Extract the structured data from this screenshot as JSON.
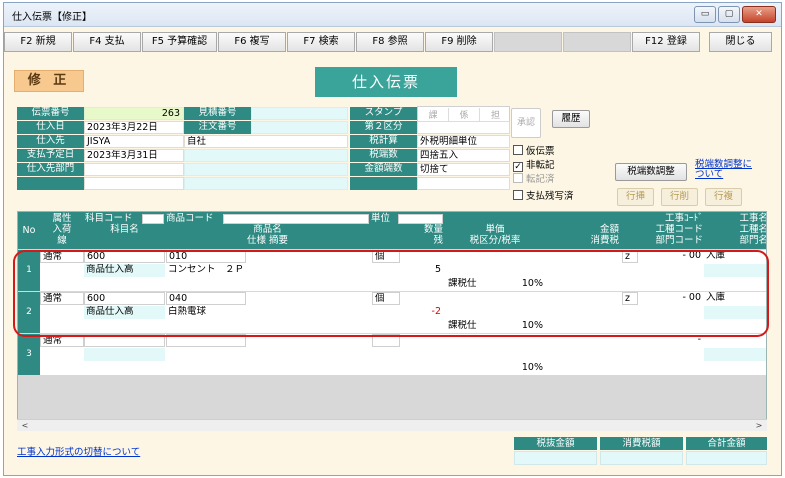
{
  "window": {
    "title": "仕入伝票【修正】",
    "min": "▭",
    "max": "▢",
    "close": "✕"
  },
  "fkeys": [
    "F2 新規",
    "F4 支払",
    "F5 予算確認",
    "F6 複写",
    "F7 検索",
    "F8 参照",
    "F9 削除",
    "",
    "",
    "F12 登録",
    "閉じる"
  ],
  "mode_label": "修 正",
  "form_title": "仕入伝票",
  "header": {
    "denpyo_label": "伝票番号",
    "denpyo_value": "263",
    "mitsumori_label": "見積番号",
    "mitsumori_value": "",
    "shiirebi_label": "仕入日",
    "shiirebi_value": "2023年3月22日",
    "chumon_label": "注文番号",
    "chumon_value": "",
    "shiiresaki_label": "仕入先",
    "shiiresaki_code": "JISYA",
    "shiiresaki_name": "自社",
    "shiharai_label": "支払予定日",
    "shiharai_value": "2023年3月31日",
    "bumon_label": "仕入先部門",
    "bumon_value": ""
  },
  "right_fields": {
    "stamp_label": "スタンプ",
    "stamps": [
      "課",
      "係",
      "担"
    ],
    "kubun2_label": "第２区分",
    "kubun2_value": "",
    "zeikeisan_label": "税計算",
    "zeikeisan_value": "外税明細単位",
    "zeihasu_label": "税端数",
    "zeihasu_value": "四捨五入",
    "kingaku_label": "金額端数",
    "kingaku_value": "切捨て"
  },
  "shonin": "承認",
  "rireki_button": "履歴",
  "checks": [
    {
      "label": "仮伝票",
      "checked": false,
      "dim": false
    },
    {
      "label": "非転記",
      "checked": true,
      "dim": false
    },
    {
      "label": "転記済",
      "checked": false,
      "dim": true
    },
    {
      "label": "支払残写済",
      "checked": false,
      "dim": false
    }
  ],
  "zeihasu_button": "税端数調整",
  "zeihasu_link": "税端数調整について",
  "row_buttons": [
    "行挿",
    "行削",
    "行複"
  ],
  "grid_header": {
    "no": "No",
    "zokusei": "属性",
    "nyuka": "入荷",
    "sen": "線",
    "kamoku_code": "科目コード",
    "kamoku_name": "科目名",
    "shohin_code": "商品コード",
    "shohin_name": "商品名",
    "shiyo": "仕様 摘要",
    "tani": "単位",
    "suryo": "数量",
    "zan": "残",
    "tanka": "単価",
    "zeikubun": "税区分/税率",
    "kingaku": "金額",
    "shohizei": "消費税",
    "koji_code": "工事ｺｰﾄﾞ",
    "kotei_code": "工種コード",
    "bumon_code": "部門コード",
    "koji_name": "工事名",
    "kotei_name": "工種名",
    "bumon_name": "部門名"
  },
  "rows": [
    {
      "no": "1",
      "zokusei": "通常",
      "kamoku_code": "600",
      "kamoku_name": "商品仕入高",
      "shohin_code": "010",
      "shohin_name": "コンセント　２Ｐ",
      "tani": "個",
      "suryo": "5",
      "suryo_neg": false,
      "zeikubun": "課税仕",
      "zeiritsu": "10%",
      "koji_code": "z",
      "koji_sub": "- 00",
      "koji_name": "入庫"
    },
    {
      "no": "2",
      "zokusei": "通常",
      "kamoku_code": "600",
      "kamoku_name": "商品仕入高",
      "shohin_code": "040",
      "shohin_name": "白熱電球",
      "tani": "個",
      "suryo": "-2",
      "suryo_neg": true,
      "zeikubun": "課税仕",
      "zeiritsu": "10%",
      "koji_code": "z",
      "koji_sub": "- 00",
      "koji_name": "入庫"
    },
    {
      "no": "3",
      "zokusei": "通常",
      "kamoku_code": "",
      "kamoku_name": "",
      "shohin_code": "",
      "shohin_name": "",
      "tani": "",
      "suryo": "",
      "suryo_neg": false,
      "zeikubun": "",
      "zeiritsu": "10%",
      "koji_code": "",
      "koji_sub": "-",
      "koji_name": ""
    }
  ],
  "footer": {
    "link": "工事入力形式の切替について",
    "zeinuki_label": "税抜金額",
    "shohizei_label": "消費税額",
    "gokei_label": "合計金額"
  },
  "scroll": {
    "left": "<",
    "right": ">"
  },
  "colors": {
    "accent": "#2e8a82",
    "mode_bg": "#f7c98f",
    "highlight": "#d81818",
    "window_bg": "#fdf6e4"
  }
}
